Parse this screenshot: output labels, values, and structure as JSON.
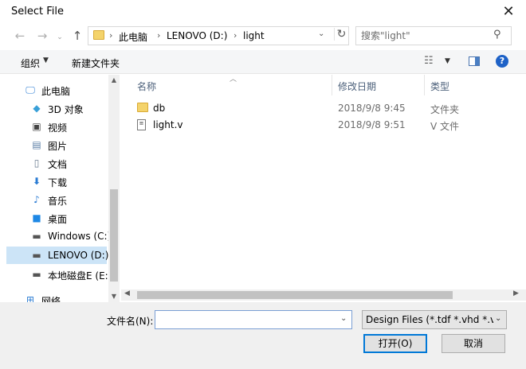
{
  "window": {
    "title": "Select File"
  },
  "address": {
    "crumbs": [
      "此电脑",
      "LENOVO (D:)",
      "light"
    ]
  },
  "search": {
    "placeholder": "搜索\"light\""
  },
  "toolbar": {
    "organize": "组织",
    "new_folder": "新建文件夹"
  },
  "nav": {
    "items": [
      {
        "label": "此电脑",
        "icon": "computer-icon"
      },
      {
        "label": "3D 对象",
        "icon": "cube-icon"
      },
      {
        "label": "视频",
        "icon": "video-icon"
      },
      {
        "label": "图片",
        "icon": "picture-icon"
      },
      {
        "label": "文档",
        "icon": "document-icon"
      },
      {
        "label": "下载",
        "icon": "download-icon"
      },
      {
        "label": "音乐",
        "icon": "music-icon"
      },
      {
        "label": "桌面",
        "icon": "desktop-icon"
      },
      {
        "label": "Windows (C:)",
        "icon": "drive-icon"
      },
      {
        "label": "LENOVO (D:)",
        "icon": "drive-icon",
        "selected": true
      },
      {
        "label": "本地磁盘E (E:)",
        "icon": "drive-icon"
      },
      {
        "label": "网络",
        "icon": "network-icon"
      }
    ]
  },
  "columns": {
    "name": "名称",
    "date": "修改日期",
    "type": "类型"
  },
  "files": [
    {
      "name": "db",
      "date": "2018/9/8 9:45",
      "type": "文件夹",
      "icon": "folder-icon"
    },
    {
      "name": "light.v",
      "date": "2018/9/8 9:51",
      "type": "V 文件",
      "icon": "file-icon"
    }
  ],
  "footer": {
    "filename_label": "文件名(N):",
    "filename_value": "",
    "filter": "Design Files (*.tdf *.vhd *.vhc",
    "open": "打开(O)",
    "cancel": "取消"
  },
  "colors": {
    "accent": "#0078d7",
    "selection": "#cce4f7",
    "folder": "#f4d36b",
    "header_text": "#4c607a"
  }
}
